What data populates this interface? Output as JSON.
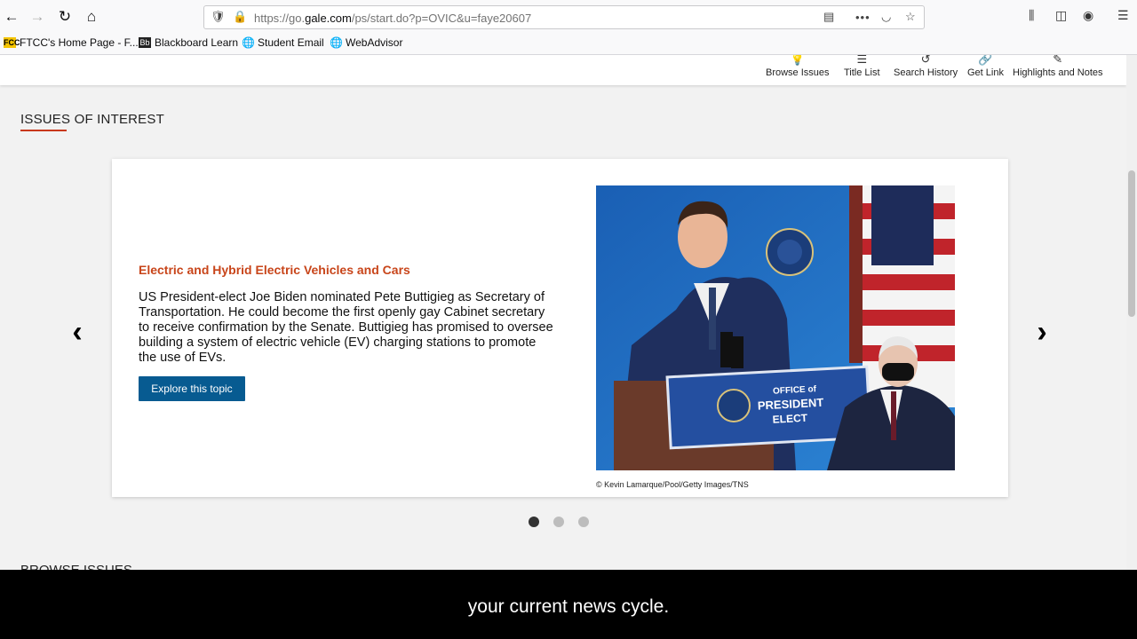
{
  "browser": {
    "url_prefix": "https://go.",
    "url_domain": "gale.com",
    "url_rest": "/ps/start.do?p=OVIC&u=faye20607",
    "more_label": "•••",
    "bookmarks": [
      {
        "label": "FTCC's Home Page - F...",
        "icon": "ftcc-icon"
      },
      {
        "label": "Blackboard Learn",
        "icon": "blackboard-icon"
      },
      {
        "label": "Student Email",
        "icon": "globe-icon"
      },
      {
        "label": "WebAdvisor",
        "icon": "globe-icon"
      }
    ]
  },
  "toolbar": {
    "items": [
      {
        "label": "Browse Issues",
        "icon": "lightbulb-icon"
      },
      {
        "label": "Title List",
        "icon": "list-icon"
      },
      {
        "label": "Search History",
        "icon": "history-icon"
      },
      {
        "label": "Get Link",
        "icon": "link-icon"
      },
      {
        "label": "Highlights and Notes",
        "icon": "highlighter-icon"
      }
    ]
  },
  "section": {
    "title": "ISSUES OF INTEREST",
    "next_title": "BROWSE ISSUES"
  },
  "feature": {
    "title": "Electric and Hybrid Electric Vehicles and Cars",
    "description": "US President-elect Joe Biden nominated Pete Buttigieg as Secretary of Transportation. He could become the first openly gay Cabinet secretary to receive confirmation by the Senate. Buttigieg has promised to oversee building a system of electric vehicle (EV) charging stations to promote the use of EVs.",
    "button_label": "Explore this topic",
    "photo_caption": "© Kevin Lamarque/Pool/Getty Images/TNS",
    "podium_text_1": "OFFICE of",
    "podium_text_2": "PRESIDENT",
    "podium_text_3": "ELECT",
    "active_slide": 1,
    "slide_count": 3
  },
  "subtitle": {
    "text": "your current news cycle."
  },
  "colors": {
    "accent": "#c8451a",
    "button": "#075b91",
    "underline": "#c8381b"
  }
}
